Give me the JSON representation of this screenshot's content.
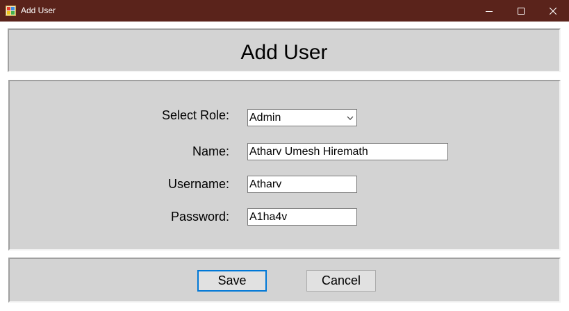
{
  "window": {
    "title": "Add User",
    "icon": "app-window-icon",
    "controls": [
      "minimize-icon",
      "maximize-icon",
      "close-icon"
    ]
  },
  "header": {
    "heading": "Add User"
  },
  "form": {
    "role": {
      "label": "Select Role:",
      "value": "Admin"
    },
    "name": {
      "label": "Name:",
      "value": "Atharv Umesh Hiremath"
    },
    "username": {
      "label": "Username:",
      "value": "Atharv"
    },
    "password": {
      "label": "Password:",
      "value": "A1ha4v"
    }
  },
  "actions": {
    "save_label": "Save",
    "cancel_label": "Cancel"
  },
  "colors": {
    "titlebar": "#5a231b",
    "panel": "#d3d3d3",
    "focus_border": "#0078d7"
  }
}
